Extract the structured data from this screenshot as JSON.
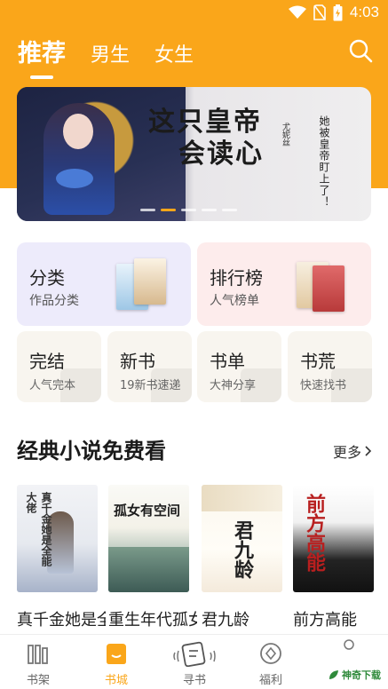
{
  "status_bar": {
    "time": "4:03"
  },
  "header": {
    "tabs": [
      {
        "label": "推荐",
        "active": true
      },
      {
        "label": "男生",
        "active": false
      },
      {
        "label": "女生",
        "active": false
      }
    ]
  },
  "banner": {
    "title_line1": "这只皇帝",
    "title_line2": "会读心",
    "author": "尤妮丝",
    "subtitle": "她被皇帝盯上了！",
    "slide_count": 5,
    "active_slide": 2
  },
  "categories": {
    "large": [
      {
        "title": "分类",
        "subtitle": "作品分类",
        "bg": "#EDEBFB"
      },
      {
        "title": "排行榜",
        "subtitle": "人气榜单",
        "bg": "#FDECEC"
      }
    ],
    "small": [
      {
        "title": "完结",
        "subtitle": "人气完本"
      },
      {
        "title": "新书",
        "subtitle": "19新书速递"
      },
      {
        "title": "书单",
        "subtitle": "大神分享"
      },
      {
        "title": "书荒",
        "subtitle": "快速找书"
      }
    ]
  },
  "section": {
    "title": "经典小说免费看",
    "more_label": "更多"
  },
  "books": [
    {
      "name": "真千金她是全能大佬",
      "cover_text": "真千金她是全能大佬"
    },
    {
      "name": "重生年代孤女有空间",
      "cover_text": "孤女有空间"
    },
    {
      "name": "君九龄",
      "cover_text": "君九龄"
    },
    {
      "name": "前方高能",
      "cover_text": "前方高能"
    }
  ],
  "bottom_nav": [
    {
      "label": "书架",
      "icon": "bookshelf-icon",
      "active": false
    },
    {
      "label": "书城",
      "icon": "bookstore-icon",
      "active": true
    },
    {
      "label": "寻书",
      "icon": "find-book-icon",
      "active": false
    },
    {
      "label": "福利",
      "icon": "welfare-icon",
      "active": false
    }
  ],
  "watermark": "神奇下载",
  "colors": {
    "accent": "#FAA61A"
  }
}
